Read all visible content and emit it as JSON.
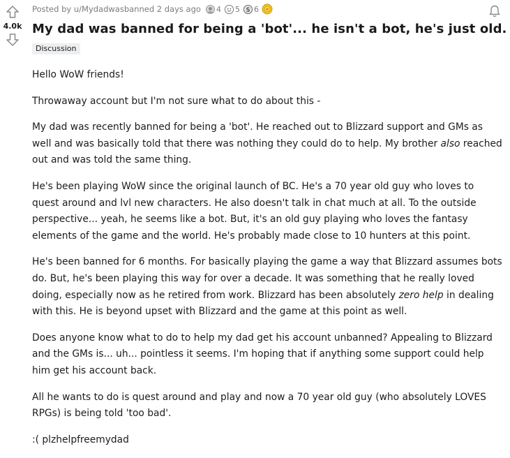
{
  "vote": {
    "score": "4.0k"
  },
  "meta": {
    "posted_by": "Posted by u/Mydadwasbanned 2 days ago",
    "awards": [
      {
        "icon": "helpful-award-icon",
        "count": "4"
      },
      {
        "icon": "wholesome-award-icon",
        "count": "5"
      },
      {
        "icon": "silver-award-icon",
        "count": "6"
      },
      {
        "icon": "gold-award-icon",
        "count": ""
      }
    ]
  },
  "post": {
    "title": "My dad was banned for being a 'bot'... he isn't a bot, he's just old.",
    "flair": "Discussion",
    "paragraphs": {
      "p1": "Hello WoW friends!",
      "p2": "Throwaway account but I'm not sure what to do about this -",
      "p3_a": "My dad was recently banned for being a 'bot'. He reached out to Blizzard support and GMs as well and was basically told that there was nothing they could do to help. My brother ",
      "p3_em": "also",
      "p3_b": " reached out and was told the same thing.",
      "p4": "He's been playing WoW since the original launch of BC. He's a 70 year old guy who loves to quest around and lvl new characters. He also doesn't talk in chat much at all. To the outside perspective... yeah, he seems like a bot. But, it's an old guy playing who loves the fantasy elements of the game and the world. He's probably made close to 10 hunters at this point.",
      "p5_a": "He's been banned for 6 months. For basically playing the game a way that Blizzard assumes bots do. But, he's been playing this way for over a decade. It was something that he really loved doing, especially now as he retired from work. Blizzard has been absolutely ",
      "p5_em": "zero help",
      "p5_b": " in dealing with this. He is beyond upset with Blizzard and the game at this point as well.",
      "p6": "Does anyone know what to do to help my dad get his account unbanned? Appealing to Blizzard and the GMs is... uh... pointless it seems. I'm hoping that if anything some support could help him get his account back.",
      "p7": "All he wants to do is quest around and play and now a 70 year old guy (who absolutely LOVES RPGs) is being told 'too bad'.",
      "p8": ":( plzhelpfreemydad"
    }
  },
  "colors": {
    "text": "#1c1c1c",
    "meta": "#7c7c7c",
    "flair_bg": "#edeff1",
    "icon": "#878a8c"
  }
}
